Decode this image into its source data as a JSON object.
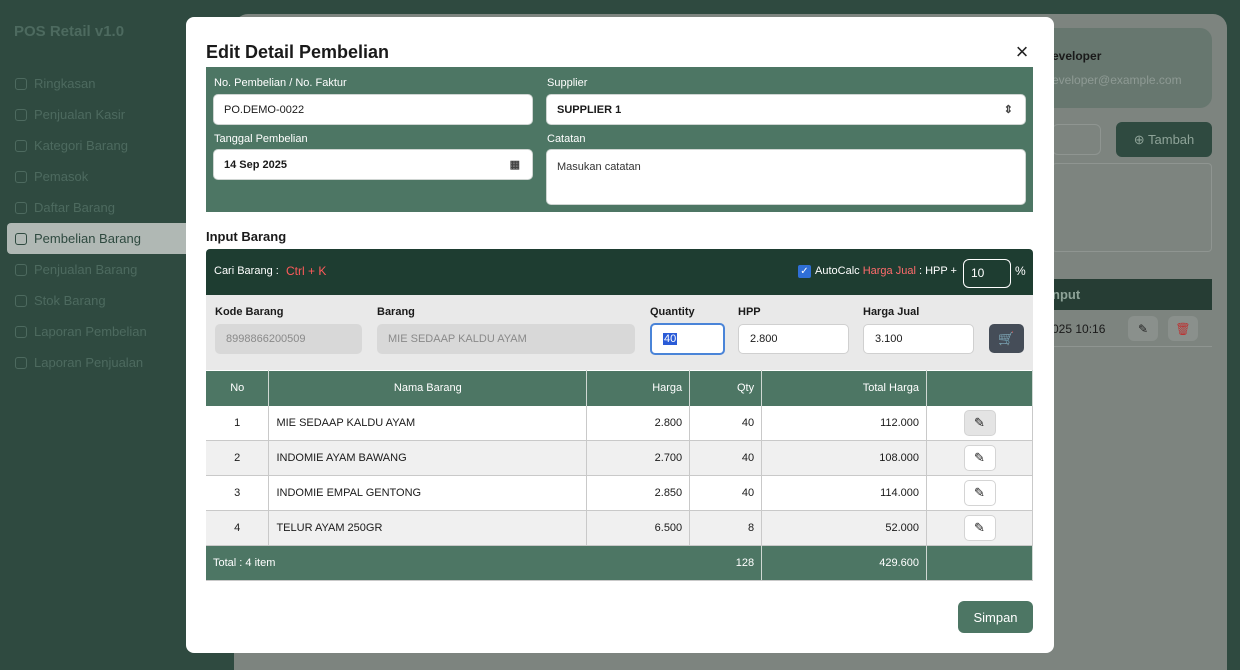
{
  "app": {
    "title": "POS Retail v1.0"
  },
  "sidebar": {
    "items": [
      {
        "label": "Ringkasan",
        "icon": "chart-icon"
      },
      {
        "label": "Penjualan Kasir",
        "icon": "scan-icon"
      },
      {
        "label": "Kategori Barang",
        "icon": "category-icon"
      },
      {
        "label": "Pemasok",
        "icon": "users-icon"
      },
      {
        "label": "Daftar Barang",
        "icon": "box-icon"
      },
      {
        "label": "Pembelian Barang",
        "icon": "basket-icon",
        "active": true
      },
      {
        "label": "Penjualan Barang",
        "icon": "cart-icon"
      },
      {
        "label": "Stok Barang",
        "icon": "archive-icon"
      },
      {
        "label": "Laporan Pembelian",
        "icon": "report-icon"
      },
      {
        "label": "Laporan Penjualan",
        "icon": "report-icon"
      }
    ]
  },
  "user": {
    "name": "eveloper",
    "email": "eveloper@example.com"
  },
  "background": {
    "add_label": "⊕ Tambah",
    "table_header": "nput",
    "row_date": "025 10:16"
  },
  "modal": {
    "title": "Edit Detail Pembelian",
    "form": {
      "no_label": "No. Pembelian / No. Faktur",
      "no_value": "PO.DEMO-0022",
      "supplier_label": "Supplier",
      "supplier_value": "SUPPLIER 1",
      "date_label": "Tanggal Pembelian",
      "date_value": "14 Sep 2025",
      "notes_label": "Catatan",
      "notes_placeholder": "Masukan catatan"
    },
    "input_section": {
      "title": "Input Barang",
      "search_label": "Cari Barang :",
      "search_shortcut": "Ctrl + K",
      "autocalc_label": "AutoCalc",
      "autocalc_highlight": "Harga Jual",
      "autocalc_suffix": ": HPP +",
      "autocalc_checked": true,
      "percent_value": "10",
      "percent_sign": "%",
      "kode_label": "Kode Barang",
      "kode_value": "8998866200509",
      "barang_label": "Barang",
      "barang_value": "MIE SEDAAP KALDU AYAM",
      "qty_label": "Quantity",
      "qty_value": "40",
      "hpp_label": "HPP",
      "hpp_value": "2.800",
      "harga_label": "Harga Jual",
      "harga_value": "3.100"
    },
    "table": {
      "headers": [
        "No",
        "Nama Barang",
        "Harga",
        "Qty",
        "Total Harga",
        ""
      ],
      "rows": [
        {
          "no": "1",
          "name": "MIE SEDAAP KALDU AYAM",
          "price": "2.800",
          "qty": "40",
          "total": "112.000"
        },
        {
          "no": "2",
          "name": "INDOMIE AYAM BAWANG",
          "price": "2.700",
          "qty": "40",
          "total": "108.000"
        },
        {
          "no": "3",
          "name": "INDOMIE EMPAL GENTONG",
          "price": "2.850",
          "qty": "40",
          "total": "114.000"
        },
        {
          "no": "4",
          "name": "TELUR AYAM 250GR",
          "price": "6.500",
          "qty": "8",
          "total": "52.000"
        }
      ],
      "footer": {
        "label": "Total : 4 item",
        "qty": "128",
        "total": "429.600"
      }
    },
    "save_label": "Simpan"
  },
  "colors": {
    "primary": "#4d7664",
    "dark": "#1e3d31",
    "sidebar": "#2f4a40",
    "accent_red": "#ff5a5a"
  }
}
